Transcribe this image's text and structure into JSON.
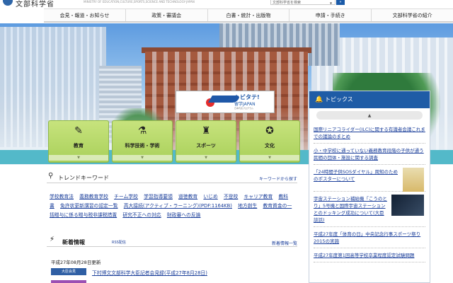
{
  "header": {
    "logo_text": "文部科学省",
    "logo_sub": "MINISTRY OF EDUCATION,CULTURE,SPORTS,SCIENCE AND TECHNOLOGY-JAPAN",
    "search_placeholder": "文部科学省を検索",
    "search_button": "»"
  },
  "gnav": [
    {
      "label": "会見・報道・お知らせ"
    },
    {
      "label": "政策・審議会"
    },
    {
      "label": "白書・統計・出版物"
    },
    {
      "label": "申請・手続き"
    },
    {
      "label": "文部科学省の紹介"
    }
  ],
  "banner": {
    "title": "トビタテ!",
    "subtitle": "留学JAPAN",
    "tagline": "日本代表プログラム"
  },
  "tiles": [
    {
      "label": "教育",
      "icon": "pencil-icon"
    },
    {
      "label": "科学技術・学術",
      "icon": "flask-icon"
    },
    {
      "label": "スポーツ",
      "icon": "runner-icon"
    },
    {
      "label": "文化",
      "icon": "medal-icon"
    }
  ],
  "topics": {
    "title": "トピックス",
    "items": [
      {
        "text": "国際リニアコライダー(ILC)に関する有識者会議これまでの議論のまとめ"
      },
      {
        "text": "小・中学校に通っていない義務教育段階の子供が通う民間の団体・施設に関する調査"
      },
      {
        "text": "「24時間子供SOSダイヤル」周知のためのポスターについて"
      },
      {
        "text": "宇宙ステーション補給機「こうのとり」5号機と国際宇宙ステーションとのドッキング成功について(大臣談話)"
      },
      {
        "text": "平成27年度「体育の日」中央記念行事スポーツ祭り2015の実施"
      },
      {
        "text": "平成27年度第1回高等学校卒業程度認定試験問題"
      }
    ]
  },
  "trend": {
    "title": "トレンドキーワード",
    "more": "キーワードから探す",
    "keywords": [
      "学校教育法",
      "義務教育学校",
      "チーム学校",
      "学習指導要領",
      "道徳教育",
      "いじめ",
      "不登校",
      "キャリア教育",
      "教科書",
      "免許状更新講習の認定一覧",
      "高大接続(アクティブ・ラーニング)(PDF:1164KB)",
      "地方創生",
      "教育資金の一括贈与に係る贈与税非課税措置",
      "研究不正への対応",
      "財政審への反論"
    ]
  },
  "news": {
    "title": "新着情報",
    "rss": "RSS配信",
    "more": "新着情報一覧",
    "date": "平成27年08月28日更新",
    "items": [
      {
        "badge": "大臣会見",
        "text": "下村博文文部科学大臣記者会見録(平成27年8月28日)"
      }
    ]
  }
}
